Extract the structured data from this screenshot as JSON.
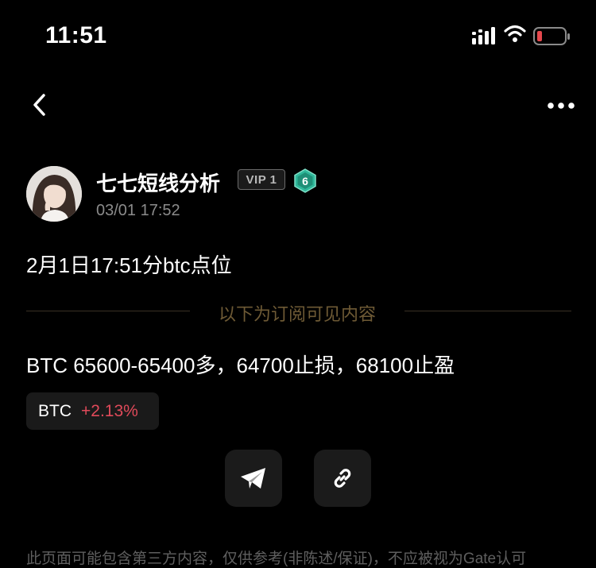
{
  "status_bar": {
    "time": "11:51",
    "icons": [
      "cellular-signal-icon",
      "wifi-icon",
      "battery-low-icon"
    ],
    "battery_color": "#e5484d"
  },
  "navigation": {
    "back_icon": "chevron-left-icon",
    "more_icon": "more-horizontal-icon"
  },
  "author": {
    "name": "七七短线分析",
    "vip_label": "VIP 1",
    "level": "6",
    "level_color": "#2fb89a",
    "post_time": "03/01 17:52"
  },
  "post": {
    "title": "2月1日17:51分btc点位",
    "subscription_notice": "以下为订阅可见内容",
    "body": "BTC 65600-65400多，64700止损，68100止盈"
  },
  "ticker": {
    "symbol": "BTC",
    "change": "+2.13%",
    "change_color": "#e04a5a"
  },
  "actions": {
    "share_telegram_icon": "telegram-send-icon",
    "copy_link_icon": "link-icon"
  },
  "footer": {
    "disclaimer": "此页面可能包含第三方内容，仅供参考(非陈述/保证)，不应被视为Gate认可"
  }
}
